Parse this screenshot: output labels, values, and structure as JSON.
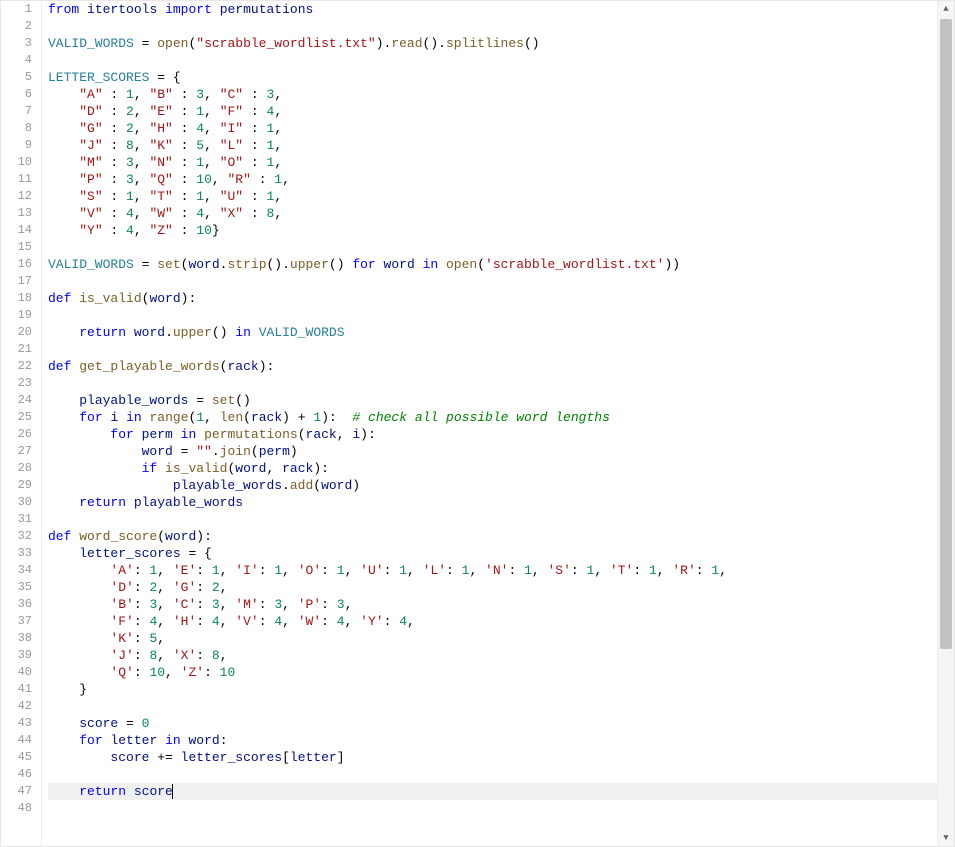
{
  "line_count": 48,
  "active_line": 47,
  "scrollbar": {
    "has_up_arrow": true,
    "has_down_arrow": true
  },
  "tokens": {
    "l1": [
      [
        "kw",
        "from"
      ],
      [
        "plain",
        " "
      ],
      [
        "id",
        "itertools"
      ],
      [
        "plain",
        " "
      ],
      [
        "kw",
        "import"
      ],
      [
        "plain",
        " "
      ],
      [
        "id",
        "permutations"
      ]
    ],
    "l2": [],
    "l3": [
      [
        "glob",
        "VALID_WORDS"
      ],
      [
        "plain",
        " = "
      ],
      [
        "fn",
        "open"
      ],
      [
        "plain",
        "("
      ],
      [
        "str",
        "\"scrabble_wordlist.txt\""
      ],
      [
        "plain",
        ")."
      ],
      [
        "fn",
        "read"
      ],
      [
        "plain",
        "()."
      ],
      [
        "fn",
        "splitlines"
      ],
      [
        "plain",
        "()"
      ]
    ],
    "l4": [],
    "l5": [
      [
        "glob",
        "LETTER_SCORES"
      ],
      [
        "plain",
        " = {"
      ]
    ],
    "l6": [
      [
        "plain",
        "    "
      ],
      [
        "str",
        "\"A\""
      ],
      [
        "plain",
        " : "
      ],
      [
        "num",
        "1"
      ],
      [
        "plain",
        ", "
      ],
      [
        "str",
        "\"B\""
      ],
      [
        "plain",
        " : "
      ],
      [
        "num",
        "3"
      ],
      [
        "plain",
        ", "
      ],
      [
        "str",
        "\"C\""
      ],
      [
        "plain",
        " : "
      ],
      [
        "num",
        "3"
      ],
      [
        "plain",
        ","
      ]
    ],
    "l7": [
      [
        "plain",
        "    "
      ],
      [
        "str",
        "\"D\""
      ],
      [
        "plain",
        " : "
      ],
      [
        "num",
        "2"
      ],
      [
        "plain",
        ", "
      ],
      [
        "str",
        "\"E\""
      ],
      [
        "plain",
        " : "
      ],
      [
        "num",
        "1"
      ],
      [
        "plain",
        ", "
      ],
      [
        "str",
        "\"F\""
      ],
      [
        "plain",
        " : "
      ],
      [
        "num",
        "4"
      ],
      [
        "plain",
        ","
      ]
    ],
    "l8": [
      [
        "plain",
        "    "
      ],
      [
        "str",
        "\"G\""
      ],
      [
        "plain",
        " : "
      ],
      [
        "num",
        "2"
      ],
      [
        "plain",
        ", "
      ],
      [
        "str",
        "\"H\""
      ],
      [
        "plain",
        " : "
      ],
      [
        "num",
        "4"
      ],
      [
        "plain",
        ", "
      ],
      [
        "str",
        "\"I\""
      ],
      [
        "plain",
        " : "
      ],
      [
        "num",
        "1"
      ],
      [
        "plain",
        ","
      ]
    ],
    "l9": [
      [
        "plain",
        "    "
      ],
      [
        "str",
        "\"J\""
      ],
      [
        "plain",
        " : "
      ],
      [
        "num",
        "8"
      ],
      [
        "plain",
        ", "
      ],
      [
        "str",
        "\"K\""
      ],
      [
        "plain",
        " : "
      ],
      [
        "num",
        "5"
      ],
      [
        "plain",
        ", "
      ],
      [
        "str",
        "\"L\""
      ],
      [
        "plain",
        " : "
      ],
      [
        "num",
        "1"
      ],
      [
        "plain",
        ","
      ]
    ],
    "l10": [
      [
        "plain",
        "    "
      ],
      [
        "str",
        "\"M\""
      ],
      [
        "plain",
        " : "
      ],
      [
        "num",
        "3"
      ],
      [
        "plain",
        ", "
      ],
      [
        "str",
        "\"N\""
      ],
      [
        "plain",
        " : "
      ],
      [
        "num",
        "1"
      ],
      [
        "plain",
        ", "
      ],
      [
        "str",
        "\"O\""
      ],
      [
        "plain",
        " : "
      ],
      [
        "num",
        "1"
      ],
      [
        "plain",
        ","
      ]
    ],
    "l11": [
      [
        "plain",
        "    "
      ],
      [
        "str",
        "\"P\""
      ],
      [
        "plain",
        " : "
      ],
      [
        "num",
        "3"
      ],
      [
        "plain",
        ", "
      ],
      [
        "str",
        "\"Q\""
      ],
      [
        "plain",
        " : "
      ],
      [
        "num",
        "10"
      ],
      [
        "plain",
        ", "
      ],
      [
        "str",
        "\"R\""
      ],
      [
        "plain",
        " : "
      ],
      [
        "num",
        "1"
      ],
      [
        "plain",
        ","
      ]
    ],
    "l12": [
      [
        "plain",
        "    "
      ],
      [
        "str",
        "\"S\""
      ],
      [
        "plain",
        " : "
      ],
      [
        "num",
        "1"
      ],
      [
        "plain",
        ", "
      ],
      [
        "str",
        "\"T\""
      ],
      [
        "plain",
        " : "
      ],
      [
        "num",
        "1"
      ],
      [
        "plain",
        ", "
      ],
      [
        "str",
        "\"U\""
      ],
      [
        "plain",
        " : "
      ],
      [
        "num",
        "1"
      ],
      [
        "plain",
        ","
      ]
    ],
    "l13": [
      [
        "plain",
        "    "
      ],
      [
        "str",
        "\"V\""
      ],
      [
        "plain",
        " : "
      ],
      [
        "num",
        "4"
      ],
      [
        "plain",
        ", "
      ],
      [
        "str",
        "\"W\""
      ],
      [
        "plain",
        " : "
      ],
      [
        "num",
        "4"
      ],
      [
        "plain",
        ", "
      ],
      [
        "str",
        "\"X\""
      ],
      [
        "plain",
        " : "
      ],
      [
        "num",
        "8"
      ],
      [
        "plain",
        ","
      ]
    ],
    "l14": [
      [
        "plain",
        "    "
      ],
      [
        "str",
        "\"Y\""
      ],
      [
        "plain",
        " : "
      ],
      [
        "num",
        "4"
      ],
      [
        "plain",
        ", "
      ],
      [
        "str",
        "\"Z\""
      ],
      [
        "plain",
        " : "
      ],
      [
        "num",
        "10"
      ],
      [
        "plain",
        "}"
      ]
    ],
    "l15": [],
    "l16": [
      [
        "glob",
        "VALID_WORDS"
      ],
      [
        "plain",
        " = "
      ],
      [
        "fn",
        "set"
      ],
      [
        "plain",
        "("
      ],
      [
        "id",
        "word"
      ],
      [
        "plain",
        "."
      ],
      [
        "fn",
        "strip"
      ],
      [
        "plain",
        "()."
      ],
      [
        "fn",
        "upper"
      ],
      [
        "plain",
        "() "
      ],
      [
        "kw",
        "for"
      ],
      [
        "plain",
        " "
      ],
      [
        "id",
        "word"
      ],
      [
        "plain",
        " "
      ],
      [
        "kw",
        "in"
      ],
      [
        "plain",
        " "
      ],
      [
        "fn",
        "open"
      ],
      [
        "plain",
        "("
      ],
      [
        "str",
        "'scrabble_wordlist.txt'"
      ],
      [
        "plain",
        "))"
      ]
    ],
    "l17": [],
    "l18": [
      [
        "kw",
        "def"
      ],
      [
        "plain",
        " "
      ],
      [
        "fn",
        "is_valid"
      ],
      [
        "plain",
        "("
      ],
      [
        "id",
        "word"
      ],
      [
        "plain",
        "):"
      ]
    ],
    "l19": [],
    "l20": [
      [
        "plain",
        "    "
      ],
      [
        "kw",
        "return"
      ],
      [
        "plain",
        " "
      ],
      [
        "id",
        "word"
      ],
      [
        "plain",
        "."
      ],
      [
        "fn",
        "upper"
      ],
      [
        "plain",
        "() "
      ],
      [
        "kw",
        "in"
      ],
      [
        "plain",
        " "
      ],
      [
        "glob",
        "VALID_WORDS"
      ]
    ],
    "l21": [],
    "l22": [
      [
        "kw",
        "def"
      ],
      [
        "plain",
        " "
      ],
      [
        "fn",
        "get_playable_words"
      ],
      [
        "plain",
        "("
      ],
      [
        "id",
        "rack"
      ],
      [
        "plain",
        "):"
      ]
    ],
    "l23": [],
    "l24": [
      [
        "plain",
        "    "
      ],
      [
        "id",
        "playable_words"
      ],
      [
        "plain",
        " = "
      ],
      [
        "fn",
        "set"
      ],
      [
        "plain",
        "()"
      ]
    ],
    "l25": [
      [
        "plain",
        "    "
      ],
      [
        "kw",
        "for"
      ],
      [
        "plain",
        " "
      ],
      [
        "id",
        "i"
      ],
      [
        "plain",
        " "
      ],
      [
        "kw",
        "in"
      ],
      [
        "plain",
        " "
      ],
      [
        "fn",
        "range"
      ],
      [
        "plain",
        "("
      ],
      [
        "num",
        "1"
      ],
      [
        "plain",
        ", "
      ],
      [
        "fn",
        "len"
      ],
      [
        "plain",
        "("
      ],
      [
        "id",
        "rack"
      ],
      [
        "plain",
        ") + "
      ],
      [
        "num",
        "1"
      ],
      [
        "plain",
        "):  "
      ],
      [
        "cm",
        "# check all possible word lengths"
      ]
    ],
    "l26": [
      [
        "plain",
        "        "
      ],
      [
        "kw",
        "for"
      ],
      [
        "plain",
        " "
      ],
      [
        "id",
        "perm"
      ],
      [
        "plain",
        " "
      ],
      [
        "kw",
        "in"
      ],
      [
        "plain",
        " "
      ],
      [
        "fn",
        "permutations"
      ],
      [
        "plain",
        "("
      ],
      [
        "id",
        "rack"
      ],
      [
        "plain",
        ", "
      ],
      [
        "id",
        "i"
      ],
      [
        "plain",
        "):"
      ]
    ],
    "l27": [
      [
        "plain",
        "            "
      ],
      [
        "id",
        "word"
      ],
      [
        "plain",
        " = "
      ],
      [
        "str",
        "\"\""
      ],
      [
        "plain",
        "."
      ],
      [
        "fn",
        "join"
      ],
      [
        "plain",
        "("
      ],
      [
        "id",
        "perm"
      ],
      [
        "plain",
        ")"
      ]
    ],
    "l28": [
      [
        "plain",
        "            "
      ],
      [
        "kw",
        "if"
      ],
      [
        "plain",
        " "
      ],
      [
        "fn",
        "is_valid"
      ],
      [
        "plain",
        "("
      ],
      [
        "id",
        "word"
      ],
      [
        "plain",
        ", "
      ],
      [
        "id",
        "rack"
      ],
      [
        "plain",
        "):"
      ]
    ],
    "l29": [
      [
        "plain",
        "                "
      ],
      [
        "id",
        "playable_words"
      ],
      [
        "plain",
        "."
      ],
      [
        "fn",
        "add"
      ],
      [
        "plain",
        "("
      ],
      [
        "id",
        "word"
      ],
      [
        "plain",
        ")"
      ]
    ],
    "l30": [
      [
        "plain",
        "    "
      ],
      [
        "kw",
        "return"
      ],
      [
        "plain",
        " "
      ],
      [
        "id",
        "playable_words"
      ]
    ],
    "l31": [],
    "l32": [
      [
        "kw",
        "def"
      ],
      [
        "plain",
        " "
      ],
      [
        "fn",
        "word_score"
      ],
      [
        "plain",
        "("
      ],
      [
        "id",
        "word"
      ],
      [
        "plain",
        "):"
      ]
    ],
    "l33": [
      [
        "plain",
        "    "
      ],
      [
        "id",
        "letter_scores"
      ],
      [
        "plain",
        " = {"
      ]
    ],
    "l34": [
      [
        "plain",
        "        "
      ],
      [
        "str",
        "'A'"
      ],
      [
        "plain",
        ": "
      ],
      [
        "num",
        "1"
      ],
      [
        "plain",
        ", "
      ],
      [
        "str",
        "'E'"
      ],
      [
        "plain",
        ": "
      ],
      [
        "num",
        "1"
      ],
      [
        "plain",
        ", "
      ],
      [
        "str",
        "'I'"
      ],
      [
        "plain",
        ": "
      ],
      [
        "num",
        "1"
      ],
      [
        "plain",
        ", "
      ],
      [
        "str",
        "'O'"
      ],
      [
        "plain",
        ": "
      ],
      [
        "num",
        "1"
      ],
      [
        "plain",
        ", "
      ],
      [
        "str",
        "'U'"
      ],
      [
        "plain",
        ": "
      ],
      [
        "num",
        "1"
      ],
      [
        "plain",
        ", "
      ],
      [
        "str",
        "'L'"
      ],
      [
        "plain",
        ": "
      ],
      [
        "num",
        "1"
      ],
      [
        "plain",
        ", "
      ],
      [
        "str",
        "'N'"
      ],
      [
        "plain",
        ": "
      ],
      [
        "num",
        "1"
      ],
      [
        "plain",
        ", "
      ],
      [
        "str",
        "'S'"
      ],
      [
        "plain",
        ": "
      ],
      [
        "num",
        "1"
      ],
      [
        "plain",
        ", "
      ],
      [
        "str",
        "'T'"
      ],
      [
        "plain",
        ": "
      ],
      [
        "num",
        "1"
      ],
      [
        "plain",
        ", "
      ],
      [
        "str",
        "'R'"
      ],
      [
        "plain",
        ": "
      ],
      [
        "num",
        "1"
      ],
      [
        "plain",
        ","
      ]
    ],
    "l35": [
      [
        "plain",
        "        "
      ],
      [
        "str",
        "'D'"
      ],
      [
        "plain",
        ": "
      ],
      [
        "num",
        "2"
      ],
      [
        "plain",
        ", "
      ],
      [
        "str",
        "'G'"
      ],
      [
        "plain",
        ": "
      ],
      [
        "num",
        "2"
      ],
      [
        "plain",
        ","
      ]
    ],
    "l36": [
      [
        "plain",
        "        "
      ],
      [
        "str",
        "'B'"
      ],
      [
        "plain",
        ": "
      ],
      [
        "num",
        "3"
      ],
      [
        "plain",
        ", "
      ],
      [
        "str",
        "'C'"
      ],
      [
        "plain",
        ": "
      ],
      [
        "num",
        "3"
      ],
      [
        "plain",
        ", "
      ],
      [
        "str",
        "'M'"
      ],
      [
        "plain",
        ": "
      ],
      [
        "num",
        "3"
      ],
      [
        "plain",
        ", "
      ],
      [
        "str",
        "'P'"
      ],
      [
        "plain",
        ": "
      ],
      [
        "num",
        "3"
      ],
      [
        "plain",
        ","
      ]
    ],
    "l37": [
      [
        "plain",
        "        "
      ],
      [
        "str",
        "'F'"
      ],
      [
        "plain",
        ": "
      ],
      [
        "num",
        "4"
      ],
      [
        "plain",
        ", "
      ],
      [
        "str",
        "'H'"
      ],
      [
        "plain",
        ": "
      ],
      [
        "num",
        "4"
      ],
      [
        "plain",
        ", "
      ],
      [
        "str",
        "'V'"
      ],
      [
        "plain",
        ": "
      ],
      [
        "num",
        "4"
      ],
      [
        "plain",
        ", "
      ],
      [
        "str",
        "'W'"
      ],
      [
        "plain",
        ": "
      ],
      [
        "num",
        "4"
      ],
      [
        "plain",
        ", "
      ],
      [
        "str",
        "'Y'"
      ],
      [
        "plain",
        ": "
      ],
      [
        "num",
        "4"
      ],
      [
        "plain",
        ","
      ]
    ],
    "l38": [
      [
        "plain",
        "        "
      ],
      [
        "str",
        "'K'"
      ],
      [
        "plain",
        ": "
      ],
      [
        "num",
        "5"
      ],
      [
        "plain",
        ","
      ]
    ],
    "l39": [
      [
        "plain",
        "        "
      ],
      [
        "str",
        "'J'"
      ],
      [
        "plain",
        ": "
      ],
      [
        "num",
        "8"
      ],
      [
        "plain",
        ", "
      ],
      [
        "str",
        "'X'"
      ],
      [
        "plain",
        ": "
      ],
      [
        "num",
        "8"
      ],
      [
        "plain",
        ","
      ]
    ],
    "l40": [
      [
        "plain",
        "        "
      ],
      [
        "str",
        "'Q'"
      ],
      [
        "plain",
        ": "
      ],
      [
        "num",
        "10"
      ],
      [
        "plain",
        ", "
      ],
      [
        "str",
        "'Z'"
      ],
      [
        "plain",
        ": "
      ],
      [
        "num",
        "10"
      ]
    ],
    "l41": [
      [
        "plain",
        "    }"
      ]
    ],
    "l42": [],
    "l43": [
      [
        "plain",
        "    "
      ],
      [
        "id",
        "score"
      ],
      [
        "plain",
        " = "
      ],
      [
        "num",
        "0"
      ]
    ],
    "l44": [
      [
        "plain",
        "    "
      ],
      [
        "kw",
        "for"
      ],
      [
        "plain",
        " "
      ],
      [
        "id",
        "letter"
      ],
      [
        "plain",
        " "
      ],
      [
        "kw",
        "in"
      ],
      [
        "plain",
        " "
      ],
      [
        "id",
        "word"
      ],
      [
        "plain",
        ":"
      ]
    ],
    "l45": [
      [
        "plain",
        "        "
      ],
      [
        "id",
        "score"
      ],
      [
        "plain",
        " += "
      ],
      [
        "id",
        "letter_scores"
      ],
      [
        "plain",
        "["
      ],
      [
        "id",
        "letter"
      ],
      [
        "plain",
        "]"
      ]
    ],
    "l46": [],
    "l47": [
      [
        "plain",
        "    "
      ],
      [
        "kw",
        "return"
      ],
      [
        "plain",
        " "
      ],
      [
        "id",
        "score"
      ]
    ],
    "l48": []
  }
}
